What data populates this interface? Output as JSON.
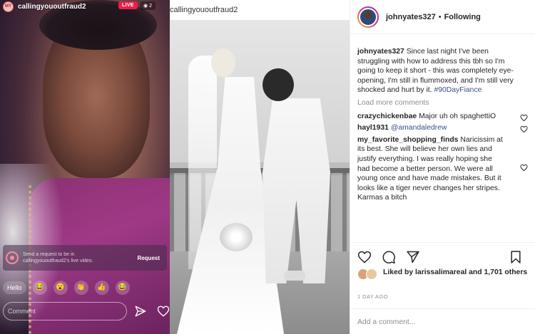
{
  "live": {
    "username": "callingyououtfraud2",
    "avatar_text": "MY",
    "live_badge": "LIVE",
    "viewer_count": "2",
    "request_prompt": "Send a request to be in callingyououtfraud2's live video.",
    "request_button": "Request",
    "reaction_hello": "Hello",
    "reactions": [
      "😂",
      "😮",
      "👏",
      "👍",
      "😂"
    ],
    "comment_placeholder": "Comment"
  },
  "photo": {
    "username": "callingyououtfraud2"
  },
  "post": {
    "owner": "johnyates327",
    "separator": "•",
    "follow_status": "Following",
    "caption_user": "johnyates327",
    "caption_text": "Since last night I've been struggling with how to address this tbh so I'm going to keep it short - this was completely eye-opening, I'm still in flummoxed, and I'm still very shocked and hurt by it.",
    "hashtag": "#90DayFiance",
    "load_more": "Load more comments",
    "comments": [
      {
        "user": "crazychickenbae",
        "text": "Major uh oh spaghettiO",
        "mention": ""
      },
      {
        "user": "hayl1931",
        "text": "",
        "mention": "@amandaledrew"
      },
      {
        "user": "my_favorite_shopping_finds",
        "text": "Naricissim at its best. She will believe her own lies and justify everything. I was really hoping she had become a better person. We were all young once and have made mistakes. But it looks like a tiger never changes her stripes. Karmas a bitch",
        "mention": ""
      }
    ],
    "likes_text": "Liked by larissalimareal and 1,701 others",
    "time": "1 DAY AGO",
    "add_comment_placeholder": "Add a comment..."
  },
  "colors": {
    "live_red": "#e6204a",
    "link_blue": "#385185",
    "muted_gray": "#8e8e8e",
    "text_dark": "#262626"
  },
  "icons": [
    "heart-icon",
    "comment-icon",
    "share-icon",
    "bookmark-icon",
    "send-icon",
    "eye-icon",
    "request-icon"
  ]
}
